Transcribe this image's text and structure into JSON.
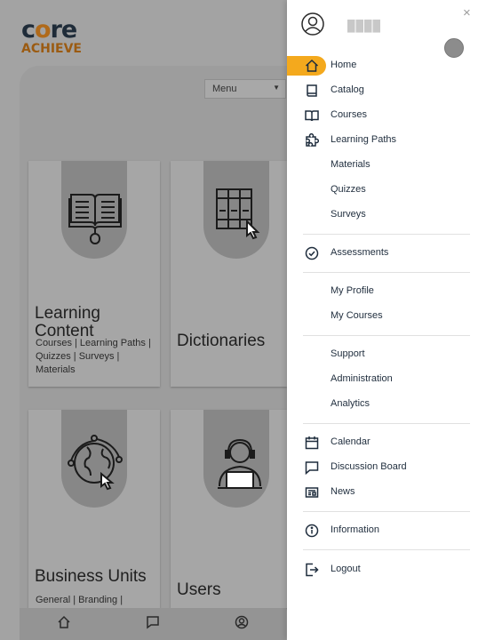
{
  "brand": {
    "logo_top": "core",
    "logo_bottom": "ACHIEVE"
  },
  "toolbar": {
    "menu_select_value": "Menu"
  },
  "cards": [
    {
      "title": "Learning Content",
      "subtitle": "Courses | Learning Paths | Quizzes | Surveys | Materials"
    },
    {
      "title": "Dictionaries"
    },
    {
      "title": "Business Units",
      "subtitle": "General | Branding |"
    },
    {
      "title": "Users"
    }
  ],
  "drawer": {
    "username": "████",
    "close": "×",
    "items": [
      {
        "label": "Home",
        "icon": "home-icon",
        "active": true
      },
      {
        "label": "Catalog",
        "icon": "catalog-icon"
      },
      {
        "label": "Courses",
        "icon": "book-open-icon"
      },
      {
        "label": "Learning Paths",
        "icon": "puzzle-icon"
      },
      {
        "label": "Materials"
      },
      {
        "label": "Quizzes"
      },
      {
        "label": "Surveys"
      },
      {
        "label": "Assessments",
        "icon": "check-circle-icon"
      },
      {
        "label": "My Profile"
      },
      {
        "label": "My Courses"
      },
      {
        "label": "Support"
      },
      {
        "label": "Administration"
      },
      {
        "label": "Analytics"
      },
      {
        "label": "Calendar",
        "icon": "calendar-icon"
      },
      {
        "label": "Discussion Board",
        "icon": "chat-icon"
      },
      {
        "label": "News",
        "icon": "news-icon"
      },
      {
        "label": "Information",
        "icon": "info-icon"
      },
      {
        "label": "Logout",
        "icon": "logout-icon"
      }
    ]
  },
  "colors": {
    "accent": "#f4a91d",
    "overlay": "#a3a3a3",
    "text": "#1f2d3d"
  }
}
